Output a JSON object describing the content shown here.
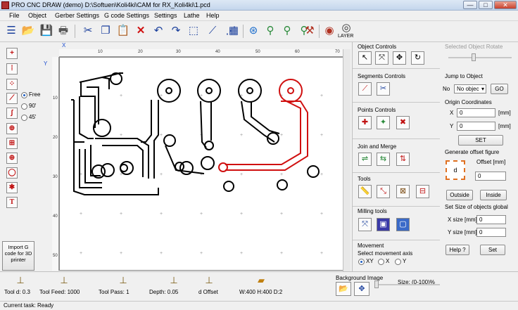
{
  "window": {
    "title": "PRO CNC DRAW (demo) D:\\Softuen\\Koli4ki\\CAM for RX_Koli4ki\\1.pcd",
    "minimize": "—",
    "maximize": "□",
    "close": "✕"
  },
  "menu": [
    "File",
    "Object",
    "Gerber Settings",
    "G code Settings",
    "Settings",
    "Lathe",
    "Help"
  ],
  "toolbar": {
    "layer_label": "LAYER",
    "icons": [
      "list-icon",
      "open-folder-icon",
      "save-icon",
      "print-icon",
      "cut-icon",
      "copy-icon",
      "paste-icon",
      "delete-icon",
      "undo-icon",
      "redo-icon",
      "select-area-icon",
      "transform-icon",
      "grid-icon",
      "grid-dots-icon",
      "mirror-icon",
      "mill-icon",
      "drill-icon",
      "laser-icon",
      "spindle-icon",
      "view-icon",
      "layer-icon"
    ]
  },
  "left_tools": {
    "draw_modes": [
      {
        "label": "Free",
        "selected": true
      },
      {
        "label": "90'",
        "selected": false
      },
      {
        "label": "45'",
        "selected": false
      }
    ],
    "import_button": "Import G code for 3D printer"
  },
  "axes": {
    "x": "X",
    "y": "Y"
  },
  "ruler": {
    "h_ticks": [
      "10",
      "20",
      "30",
      "40",
      "50",
      "60",
      "70"
    ],
    "v_ticks": [
      "10",
      "20",
      "30",
      "40",
      "50"
    ]
  },
  "right_panel": {
    "object_controls": "Object Controls",
    "segments_controls": "Segments Controls",
    "points_controls": "Points Controls",
    "join_merge": "Join and Merge",
    "tools": "Tools",
    "milling_tools": "Milling tools",
    "movement": "Movement",
    "movement_axis_label": "Select movement axis",
    "axis_options": [
      {
        "label": "XY",
        "selected": true
      },
      {
        "label": "X",
        "selected": false
      },
      {
        "label": "Y",
        "selected": false
      }
    ]
  },
  "far_panel": {
    "selected_object_rotate": "Selected Object Rotate",
    "jump_to_object": "Jump to Object",
    "no_label": "No",
    "no_object_select": "No objec",
    "go_button": "GO",
    "origin_coordinates": "Origin Coordinates",
    "x_label": "X",
    "x_value": "0",
    "x_unit": "[mm]",
    "y_label": "Y",
    "y_value": "0",
    "y_unit": "[mm]",
    "set_button": "SET",
    "generate_offset": "Generate offset figure",
    "offset_label": "Offset [mm]",
    "offset_value": "0",
    "outside_button": "Outside",
    "inside_button": "Inside",
    "set_size_label": "Set Size of objects global",
    "xsize_label": "X size [mm]",
    "xsize_value": "0",
    "ysize_label": "Y size [mm]",
    "ysize_value": "0",
    "help_button": "Help ?",
    "set2_button": "Set"
  },
  "bottom": {
    "tool_d": "Tool d: 0.3",
    "tool_feed": "Tool Feed: 1000",
    "tool_pass": "Tool Pass: 1",
    "depth": "Depth: 0.05",
    "d_offset": "d Offset",
    "wh_d": "W:400 H:400 D:2",
    "background_image": "Background Image",
    "size_label": "Size: (0-100)%"
  },
  "status": {
    "text": "Current task: Ready"
  },
  "colors": {
    "selected_trace": "#d01010",
    "trace": "#000000"
  }
}
